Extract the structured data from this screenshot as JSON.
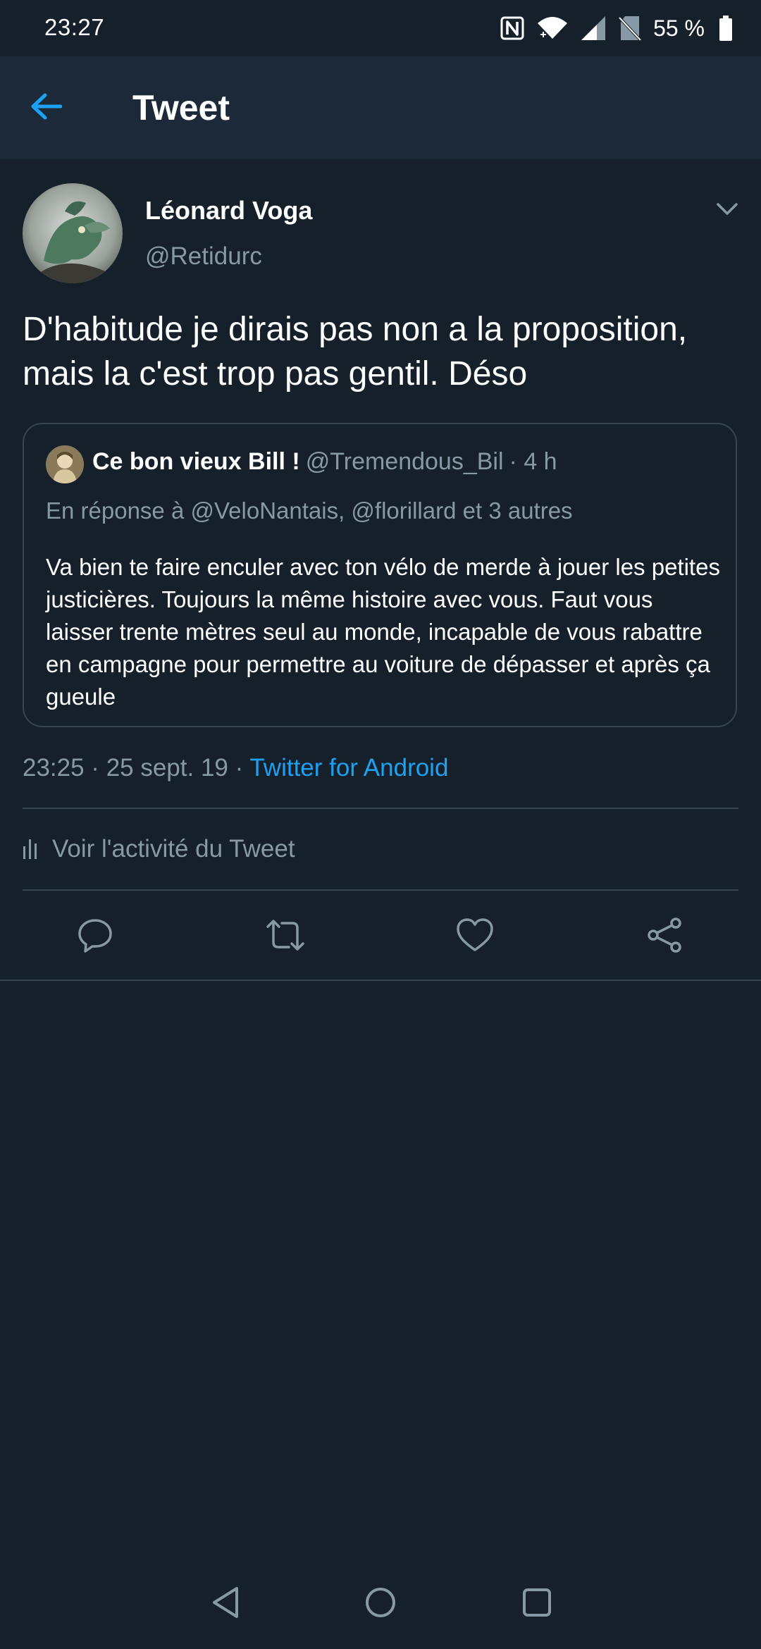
{
  "status_bar": {
    "time": "23:27",
    "battery_percent": "55 %",
    "icons": [
      "nfc-icon",
      "wifi-icon",
      "signal-icon",
      "no-sim-icon",
      "battery-icon"
    ]
  },
  "app_bar": {
    "title": "Tweet",
    "back_icon": "arrow-left-icon"
  },
  "tweet": {
    "author_name": "Léonard Voga",
    "author_handle": "@Retidurc",
    "text": "D'habitude je dirais pas non a la proposition, mais la c'est trop pas gentil. Déso",
    "quoted": {
      "name": "Ce bon vieux Bill !",
      "handle": "@Tremendous_Bil",
      "time": "· 4 h",
      "reply_to": "En réponse à @VeloNantais, @florillard et 3 autres",
      "text": "Va bien te faire enculer avec ton vélo de merde à jouer les petites justicières. Toujours la même histoire avec vous. Faut vous laisser trente mètres seul au monde, incapable de vous rabattre en campagne pour permettre au voiture de dépasser et après ça gueule"
    },
    "timestamp": "23:25 · 25 sept. 19 · ",
    "source": "Twitter for Android",
    "activity_label": "Voir l'activité du Tweet"
  },
  "actions": [
    "reply-icon",
    "retweet-icon",
    "like-icon",
    "share-icon"
  ],
  "navigation": [
    "nav-back-icon",
    "nav-home-icon",
    "nav-recents-icon"
  ],
  "colors": {
    "background": "#15202b",
    "app_bar": "#1c2938",
    "accent": "#1da1f2",
    "secondary_text": "#8899a6",
    "border": "#38444d"
  }
}
